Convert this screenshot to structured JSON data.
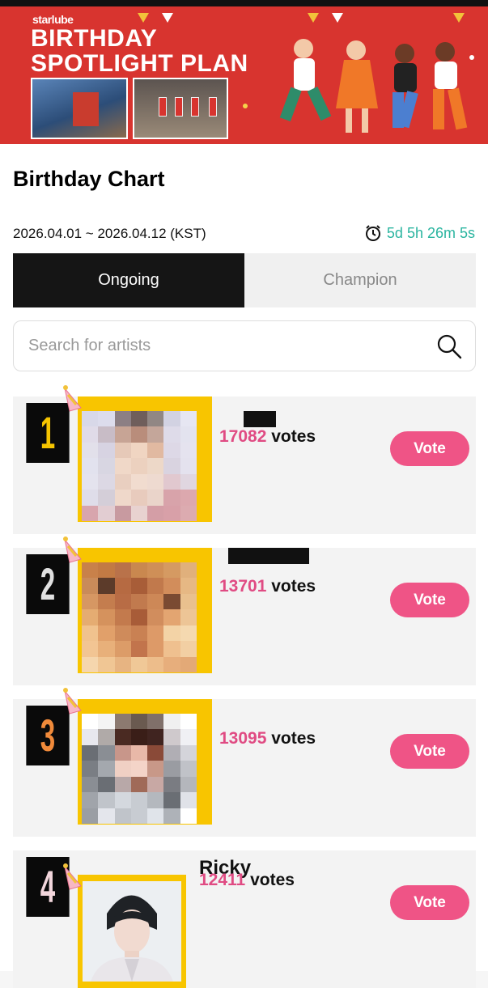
{
  "banner": {
    "brand": "starlube",
    "title_line1": "BIRTHDAY",
    "title_line2": "SPOTLIGHT PLAN"
  },
  "chart": {
    "title": "Birthday Chart",
    "date_range": "2026.04.01 ~ 2026.04.12 (KST)",
    "countdown": "5d 5h 26m 5s"
  },
  "tabs": [
    {
      "label": "Ongoing",
      "active": true
    },
    {
      "label": "Champion",
      "active": false
    }
  ],
  "search": {
    "placeholder": "Search for artists"
  },
  "colors": {
    "accent_pink": "#ef5486",
    "vote_number": "#e04b83",
    "countdown": "#2bb5a0",
    "frame_gold": "#f8c500",
    "banner_red": "#d8342f"
  },
  "entries": [
    {
      "rank": "1",
      "name": "",
      "votes": "17082",
      "votes_label": "votes",
      "vote_button": "Vote",
      "rank_color": "#f5c400"
    },
    {
      "rank": "2",
      "name": "",
      "votes": "13701",
      "votes_label": "votes",
      "vote_button": "Vote",
      "rank_color": "#e0e0e0"
    },
    {
      "rank": "3",
      "name": "",
      "votes": "13095",
      "votes_label": "votes",
      "vote_button": "Vote",
      "rank_color": "#f08a3a"
    },
    {
      "rank": "4",
      "name": "Ricky",
      "votes": "12411",
      "votes_label": "votes",
      "vote_button": "Vote",
      "rank_color": "#f2d6dc"
    }
  ]
}
